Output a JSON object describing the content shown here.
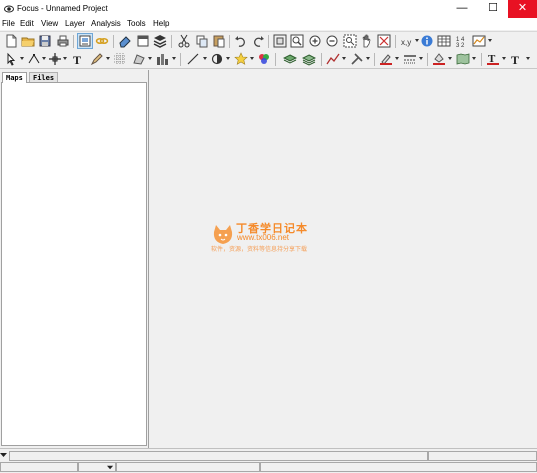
{
  "window": {
    "title": "Focus - Unnamed Project",
    "minimize_glyph": "—",
    "maximize_glyph": "☐",
    "close_glyph": "✕"
  },
  "menu": [
    "File",
    "Edit",
    "View",
    "Layer",
    "Analysis",
    "Tools",
    "Help"
  ],
  "panel": {
    "tabs": [
      "Maps",
      "Files"
    ],
    "active_tab": "Maps"
  },
  "watermark": {
    "title": "丁香学日记本",
    "url": "www.tx006.net",
    "subtitle": "软件，资源，资料等信息持分享下载"
  },
  "colors": {
    "close_button": "#e81123",
    "watermark": "#f58a2a",
    "active_tool": "#cce4f7"
  },
  "toolbar1_icons": [
    "new-icon",
    "open-folder-icon",
    "save-icon",
    "print-icon",
    "layout-icon",
    "link-icon",
    "eraser-icon",
    "window-icon",
    "layers-stack-icon",
    "cut-icon",
    "copy-icon",
    "paste-icon",
    "undo-icon",
    "redo-icon",
    "zoom-extent-icon",
    "zoom-layer-icon",
    "zoom-in-icon",
    "zoom-out-icon",
    "zoom-selection-icon",
    "pan-hand-icon",
    "zoom-rect-icon",
    "coordinate-xy-icon",
    "info-icon",
    "table-icon",
    "measure-icon",
    "chart-icon"
  ],
  "toolbar2_icons": [
    "select-arrow-icon",
    "vertex-tool-icon",
    "move-cross-icon",
    "text-tool-icon",
    "edit-tool-icon",
    "grid-tool-icon",
    "shape-tool-icon",
    "buildings-icon",
    "line-tool-icon",
    "circle-tool-icon",
    "star-tool-icon",
    "palette-icon",
    "layer-add-icon",
    "layer-remove-icon",
    "analysis-icon",
    "tools-icon",
    "line-color-icon",
    "line-style-icon",
    "fill-color-icon",
    "map-icon",
    "font-color-icon",
    "font-size-icon"
  ]
}
